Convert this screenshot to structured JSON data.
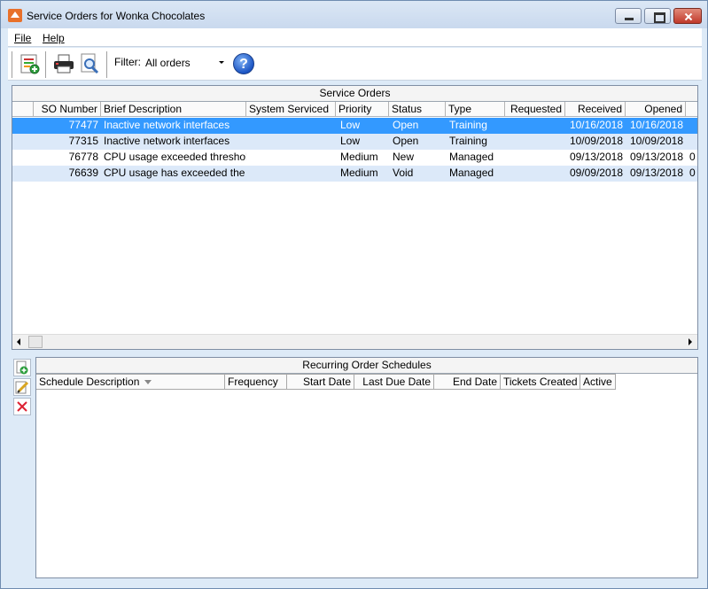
{
  "window": {
    "title": "Service Orders for Wonka Chocolates"
  },
  "menu": {
    "file": "File",
    "help": "Help"
  },
  "toolbar": {
    "filter_label": "Filter:",
    "filter_value": "All orders",
    "icons": [
      "new-order-icon",
      "print-icon",
      "print-preview-icon",
      "help-icon"
    ]
  },
  "service_orders": {
    "caption": "Service Orders",
    "columns": [
      "SO Number",
      "Brief Description",
      "System Serviced",
      "Priority",
      "Status",
      "Type",
      "Requested",
      "Received",
      "Opened"
    ],
    "rows": [
      {
        "so_number": "77477",
        "description": "Inactive network interfaces",
        "system": "",
        "priority": "Low",
        "status": "Open",
        "type": "Training",
        "requested": "",
        "received": "10/16/2018",
        "opened": "10/16/2018",
        "extra": ""
      },
      {
        "so_number": "77315",
        "description": "Inactive network interfaces",
        "system": "",
        "priority": "Low",
        "status": "Open",
        "type": "Training",
        "requested": "",
        "received": "10/09/2018",
        "opened": "10/09/2018",
        "extra": ""
      },
      {
        "so_number": "76778",
        "description": "CPU usage exceeded threshold",
        "system": "",
        "priority": "Medium",
        "status": "New",
        "type": "Managed",
        "requested": "",
        "received": "09/13/2018",
        "opened": "09/13/2018",
        "extra": "0"
      },
      {
        "so_number": "76639",
        "description": "CPU usage has exceeded the",
        "system": "",
        "priority": "Medium",
        "status": "Void",
        "type": "Managed",
        "requested": "",
        "received": "09/09/2018",
        "opened": "09/13/2018",
        "extra": "0"
      }
    ],
    "selected_row": 0
  },
  "recurring": {
    "caption": "Recurring Order Schedules",
    "columns": [
      "Schedule Description",
      "Frequency",
      "Start Date",
      "Last Due Date",
      "End Date",
      "Tickets Created",
      "Active"
    ]
  },
  "colors": {
    "selection": "#3399ff",
    "alt_row": "#dce9f9",
    "window_bg": "#ddeaf7"
  }
}
